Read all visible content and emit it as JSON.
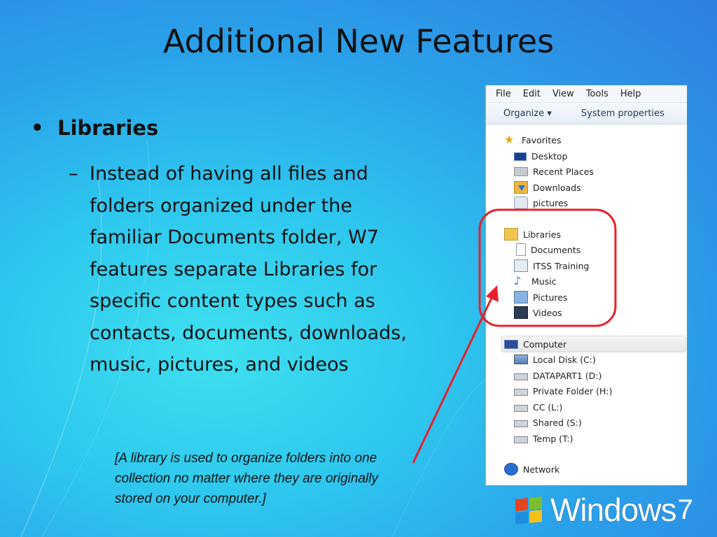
{
  "slide": {
    "title": "Additional New Features",
    "bullet": "Libraries",
    "bullet_marker": "•",
    "sub_dash": "–",
    "sub_text": "Instead of having all files and folders organized under the familiar Documents folder, W7 features separate Libraries for specific content types such as contacts, documents, downloads, music, pictures, and videos",
    "note": "[A library is used to organize folders into one collection no matter where they are originally stored on your computer.]"
  },
  "explorer": {
    "menu": [
      "File",
      "Edit",
      "View",
      "Tools",
      "Help"
    ],
    "toolbar": {
      "organize": "Organize ▾",
      "system_properties": "System properties"
    },
    "favorites": {
      "label": "Favorites",
      "items": [
        "Desktop",
        "Recent Places",
        "Downloads",
        "pictures"
      ]
    },
    "libraries": {
      "label": "Libraries",
      "items": [
        "Documents",
        "ITSS Training",
        "Music",
        "Pictures",
        "Videos"
      ]
    },
    "computer": {
      "label": "Computer",
      "items": [
        "Local Disk (C:)",
        "DATAPART1 (D:)",
        "Private Folder (H:)",
        "CC (L:)",
        "Shared (S:)",
        "Temp (T:)"
      ]
    },
    "network": {
      "label": "Network"
    }
  },
  "logo": {
    "brand": "Windows",
    "version": "7"
  },
  "colors": {
    "highlight_red": "#e8202a",
    "accent_blue": "#2aa2ea"
  },
  "icons": {
    "favorites": "star-icon",
    "desktop": "desktop-icon",
    "recent": "recent-places-icon",
    "downloads": "downloads-icon",
    "pictures_fav": "pictures-folder-icon",
    "libraries": "libraries-icon",
    "documents": "documents-icon",
    "itss": "itss-training-icon",
    "music": "music-icon",
    "pictures": "pictures-icon",
    "videos": "videos-icon",
    "computer": "computer-icon",
    "local_disk": "local-disk-icon",
    "drive": "network-drive-icon",
    "network": "network-icon"
  }
}
